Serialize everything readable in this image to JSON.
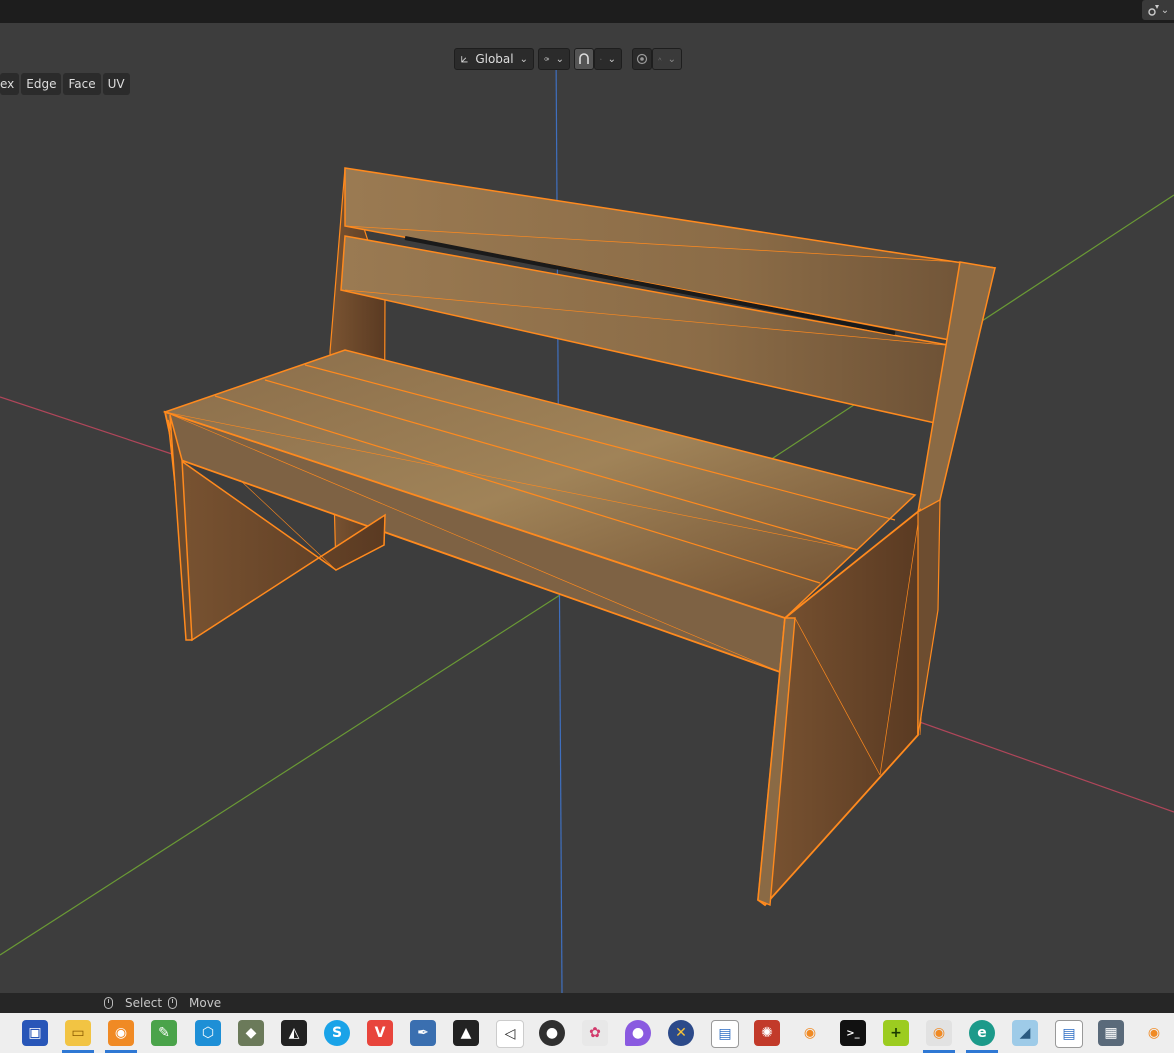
{
  "header": {
    "transform_orientation": "Global",
    "pivot_icon": "pivot-icon",
    "snap_icon": "snap-magnet-icon",
    "snap_target_icon": "snap-increment-icon",
    "proportional_icon": "proportional-edit-icon",
    "falloff_icon": "falloff-curve-icon"
  },
  "menu": {
    "items": [
      "ex",
      "Edge",
      "Face",
      "UV"
    ]
  },
  "statusbar": {
    "select_label": "Select",
    "move_label": "Move"
  },
  "colors": {
    "accent_orange": "#ff8a1e",
    "viewport_bg": "#3d3d3d",
    "axis_x": "#b0465a",
    "axis_y": "#6a9a35",
    "axis_z": "#3f6fbf"
  },
  "taskbar": {
    "icons": [
      "save-icon",
      "file-explorer-icon",
      "blender-orange-icon",
      "notepad-icon",
      "box-3d-icon",
      "tank-icon",
      "unity-icon",
      "skype-icon",
      "vivaldi-icon",
      "quill-icon",
      "inkscape-icon",
      "unity-hub-icon",
      "obs-icon",
      "krita-icon",
      "droplet-icon",
      "xampp-icon",
      "window-icon",
      "bug-icon",
      "blender-icon",
      "terminal-icon",
      "plus-monitor-icon",
      "blender-active-icon",
      "edge-browser-icon",
      "eraser-icon",
      "window-icon-2",
      "calculator-icon",
      "blender-icon-2"
    ]
  }
}
